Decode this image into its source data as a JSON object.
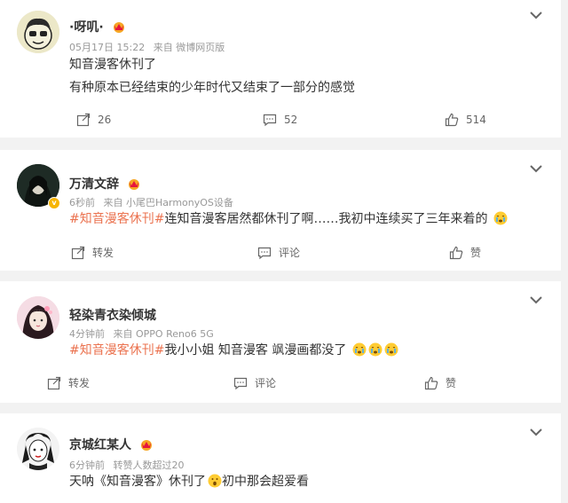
{
  "posts": [
    {
      "name": "·呀叽·",
      "time": "05月17日 15:22",
      "source": "来自 微博网页版",
      "line1": "知音漫客休刊了",
      "line2": "有种原本已经结束的少年时代又结束了一部分的感觉",
      "repost": "26",
      "comment": "52",
      "like": "514"
    },
    {
      "name": "万清文辞",
      "time": "6秒前",
      "source": "来自 小尾巴HarmonyOS设备",
      "tag": "#知音漫客休刊#",
      "text": "连知音漫客居然都休刊了啊……我初中连续买了三年来着的",
      "repost": "转发",
      "comment": "评论",
      "like": "赞"
    },
    {
      "name": "轻染青衣染倾城",
      "time": "4分钟前",
      "source": "来自 OPPO Reno6 5G",
      "tag": "#知音漫客休刊#",
      "text": "我小小姐 知音漫客 飒漫画都没了",
      "repost": "转发",
      "comment": "评论",
      "like": "赞"
    },
    {
      "name": "京城红某人",
      "time": "6分钟前",
      "source": "转赞人数超过20",
      "text_before": "天呐《知音漫客》休刊了",
      "text_after": "初中那会超爱看"
    }
  ],
  "icons": [
    "chevron-down-icon",
    "repost-icon",
    "comment-icon",
    "like-icon",
    "vip-crown-icon",
    "crying-emoji-icon",
    "shocked-emoji-icon",
    "verified-badge-icon"
  ],
  "colors": {
    "tag": "#eb7350",
    "text": "#333333",
    "meta": "#999999",
    "background": "#f2f2f2"
  }
}
